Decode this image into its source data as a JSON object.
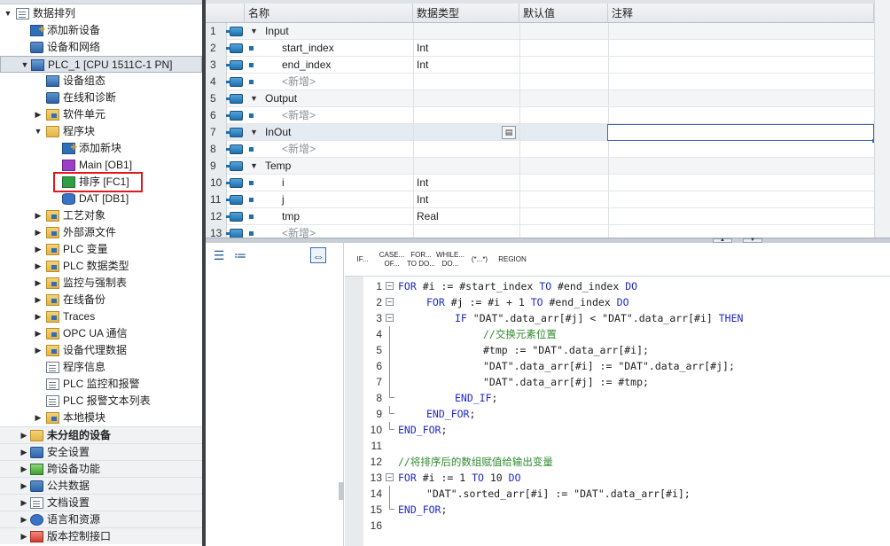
{
  "tree": {
    "items": [
      {
        "label": "数据排列",
        "icon": "project-doc-icon",
        "arrow": "▼",
        "level": 0,
        "kind": "i-doc"
      },
      {
        "label": "添加新设备",
        "icon": "add-device-icon",
        "arrow": "",
        "level": 1,
        "kind": "i-add"
      },
      {
        "label": "设备和网络",
        "icon": "network-icon",
        "arrow": "",
        "level": 1,
        "kind": "i-net"
      },
      {
        "label": "PLC_1 [CPU 1511C-1 PN]",
        "icon": "plc-icon",
        "arrow": "▼",
        "level": 1,
        "kind": "i-plc",
        "selected": true
      },
      {
        "label": "设备组态",
        "icon": "device-config-icon",
        "arrow": "",
        "level": 2,
        "kind": "i-plc"
      },
      {
        "label": "在线和诊断",
        "icon": "diagnostics-icon",
        "arrow": "",
        "level": 2,
        "kind": "i-net"
      },
      {
        "label": "软件单元",
        "icon": "software-units-icon",
        "arrow": "▶",
        "level": 2,
        "kind": "i-folderb"
      },
      {
        "label": "程序块",
        "icon": "program-blocks-folder-icon",
        "arrow": "▼",
        "level": 2,
        "kind": "i-folder"
      },
      {
        "label": "添加新块",
        "icon": "add-block-icon",
        "arrow": "",
        "level": 3,
        "kind": "i-add"
      },
      {
        "label": "Main [OB1]",
        "icon": "ob-block-icon",
        "arrow": "",
        "level": 3,
        "kind": "i-ob"
      },
      {
        "label": "排序 [FC1]",
        "icon": "fc-block-icon",
        "arrow": "",
        "level": 3,
        "kind": "i-fc"
      },
      {
        "label": "DAT [DB1]",
        "icon": "db-block-icon",
        "arrow": "",
        "level": 3,
        "kind": "i-db"
      },
      {
        "label": "工艺对象",
        "icon": "technology-objects-icon",
        "arrow": "▶",
        "level": 2,
        "kind": "i-folderb"
      },
      {
        "label": "外部源文件",
        "icon": "external-sources-icon",
        "arrow": "▶",
        "level": 2,
        "kind": "i-folderb"
      },
      {
        "label": "PLC 变量",
        "icon": "plc-tags-icon",
        "arrow": "▶",
        "level": 2,
        "kind": "i-folderb"
      },
      {
        "label": "PLC 数据类型",
        "icon": "plc-datatypes-icon",
        "arrow": "▶",
        "level": 2,
        "kind": "i-folderb"
      },
      {
        "label": "监控与强制表",
        "icon": "watch-tables-icon",
        "arrow": "▶",
        "level": 2,
        "kind": "i-folderb"
      },
      {
        "label": "在线备份",
        "icon": "online-backup-icon",
        "arrow": "▶",
        "level": 2,
        "kind": "i-folderb"
      },
      {
        "label": "Traces",
        "icon": "traces-icon",
        "arrow": "▶",
        "level": 2,
        "kind": "i-folderb"
      },
      {
        "label": "OPC UA 通信",
        "icon": "opcua-icon",
        "arrow": "▶",
        "level": 2,
        "kind": "i-folderb"
      },
      {
        "label": "设备代理数据",
        "icon": "device-proxy-icon",
        "arrow": "▶",
        "level": 2,
        "kind": "i-folderb"
      },
      {
        "label": "程序信息",
        "icon": "program-info-icon",
        "arrow": "",
        "level": 2,
        "kind": "i-doc"
      },
      {
        "label": "PLC 监控和报警",
        "icon": "plc-alarms-icon",
        "arrow": "",
        "level": 2,
        "kind": "i-doc"
      },
      {
        "label": "PLC 报警文本列表",
        "icon": "alarm-text-list-icon",
        "arrow": "",
        "level": 2,
        "kind": "i-doc"
      },
      {
        "label": "本地模块",
        "icon": "local-modules-icon",
        "arrow": "▶",
        "level": 2,
        "kind": "i-folderb"
      },
      {
        "label": "未分组的设备",
        "icon": "ungrouped-devices-icon",
        "arrow": "▶",
        "level": 1,
        "kind": "i-folder",
        "group": true,
        "bold": true
      },
      {
        "label": "安全设置",
        "icon": "security-icon",
        "arrow": "▶",
        "level": 1,
        "kind": "i-net",
        "group": true
      },
      {
        "label": "跨设备功能",
        "icon": "cross-device-icon",
        "arrow": "▶",
        "level": 1,
        "kind": "i-green",
        "group": true
      },
      {
        "label": "公共数据",
        "icon": "common-data-icon",
        "arrow": "▶",
        "level": 1,
        "kind": "i-net",
        "group": true
      },
      {
        "label": "文档设置",
        "icon": "document-settings-icon",
        "arrow": "▶",
        "level": 1,
        "kind": "i-doc",
        "group": true
      },
      {
        "label": "语言和资源",
        "icon": "language-icon",
        "arrow": "▶",
        "level": 1,
        "kind": "i-gear",
        "group": true
      },
      {
        "label": "版本控制接口",
        "icon": "version-control-icon",
        "arrow": "▶",
        "level": 1,
        "kind": "i-red",
        "group": true
      }
    ]
  },
  "interface": {
    "headers": {
      "name": "名称",
      "type": "数据类型",
      "default": "默认值",
      "comment": "注释"
    },
    "rows": [
      {
        "no": "1",
        "name": "Input",
        "type": "",
        "section": true
      },
      {
        "no": "2",
        "name": "start_index",
        "type": "Int"
      },
      {
        "no": "3",
        "name": "end_index",
        "type": "Int"
      },
      {
        "no": "4",
        "name": "<新增>",
        "type": "",
        "placeholder": true
      },
      {
        "no": "5",
        "name": "Output",
        "type": "",
        "section": true
      },
      {
        "no": "6",
        "name": "<新增>",
        "type": "",
        "placeholder": true
      },
      {
        "no": "7",
        "name": "InOut",
        "type": "",
        "section": true,
        "selected": true
      },
      {
        "no": "8",
        "name": "<新增>",
        "type": "",
        "placeholder": true
      },
      {
        "no": "9",
        "name": "Temp",
        "type": "",
        "section": true
      },
      {
        "no": "10",
        "name": "i",
        "type": "Int"
      },
      {
        "no": "11",
        "name": "j",
        "type": "Int"
      },
      {
        "no": "12",
        "name": "tmp",
        "type": "Real"
      },
      {
        "no": "13",
        "name": "<新增>",
        "type": "",
        "placeholder": true
      }
    ]
  },
  "editor": {
    "toolbar": [
      {
        "label": "IF...",
        "name": "if-button"
      },
      {
        "label": "CASE...\nOF...",
        "name": "case-of-button"
      },
      {
        "label": "FOR...\nTO DO...",
        "name": "for-to-do-button"
      },
      {
        "label": "WHILE...\nDO...",
        "name": "while-do-button"
      },
      {
        "label": "(*...*)",
        "name": "comment-button"
      },
      {
        "label": "REGION",
        "name": "region-button"
      }
    ],
    "lines": [
      {
        "no": "1",
        "fold": "open",
        "indent": 0,
        "parts": [
          [
            "kw",
            "FOR "
          ],
          [
            "tx",
            "#i := #start_index "
          ],
          [
            "kw",
            "TO "
          ],
          [
            "tx",
            "#end_index "
          ],
          [
            "kw",
            "DO"
          ]
        ]
      },
      {
        "no": "2",
        "fold": "open",
        "indent": 4,
        "parts": [
          [
            "kw",
            "FOR "
          ],
          [
            "tx",
            "#j := #i + 1 "
          ],
          [
            "kw",
            "TO "
          ],
          [
            "tx",
            "#end_index "
          ],
          [
            "kw",
            "DO"
          ]
        ]
      },
      {
        "no": "3",
        "fold": "open",
        "indent": 8,
        "parts": [
          [
            "kw",
            "IF "
          ],
          [
            "tx",
            "\"DAT\".data_arr[#j] < \"DAT\".data_arr[#i] "
          ],
          [
            "kw",
            "THEN"
          ]
        ]
      },
      {
        "no": "4",
        "fold": "line",
        "indent": 12,
        "parts": [
          [
            "cm",
            "//交换元素位置"
          ]
        ]
      },
      {
        "no": "5",
        "fold": "line",
        "indent": 12,
        "parts": [
          [
            "tx",
            "#tmp := \"DAT\".data_arr[#i];"
          ]
        ]
      },
      {
        "no": "6",
        "fold": "line",
        "indent": 12,
        "parts": [
          [
            "tx",
            "\"DAT\".data_arr[#i] := \"DAT\".data_arr[#j];"
          ]
        ]
      },
      {
        "no": "7",
        "fold": "line",
        "indent": 12,
        "parts": [
          [
            "tx",
            "\"DAT\".data_arr[#j] := #tmp;"
          ]
        ]
      },
      {
        "no": "8",
        "fold": "end",
        "indent": 8,
        "parts": [
          [
            "kw",
            "END_IF"
          ],
          [
            "tx",
            ";"
          ]
        ]
      },
      {
        "no": "9",
        "fold": "end",
        "indent": 4,
        "parts": [
          [
            "kw",
            "END_FOR"
          ],
          [
            "tx",
            ";"
          ]
        ]
      },
      {
        "no": "10",
        "fold": "end",
        "indent": 0,
        "parts": [
          [
            "kw",
            "END_FOR"
          ],
          [
            "tx",
            ";"
          ]
        ]
      },
      {
        "no": "11",
        "fold": "",
        "indent": 0,
        "parts": []
      },
      {
        "no": "12",
        "fold": "",
        "indent": 0,
        "parts": [
          [
            "cm",
            "//将排序后的数组赋值给输出变量"
          ]
        ]
      },
      {
        "no": "13",
        "fold": "open",
        "indent": 0,
        "parts": [
          [
            "kw",
            "FOR "
          ],
          [
            "tx",
            "#i := 1 "
          ],
          [
            "kw",
            "TO "
          ],
          [
            "tx",
            "10 "
          ],
          [
            "kw",
            "DO"
          ]
        ]
      },
      {
        "no": "14",
        "fold": "line",
        "indent": 4,
        "parts": [
          [
            "tx",
            "\"DAT\".sorted_arr[#i] := \"DAT\".data_arr[#i];"
          ]
        ]
      },
      {
        "no": "15",
        "fold": "end",
        "indent": 0,
        "parts": [
          [
            "kw",
            "END_FOR"
          ],
          [
            "tx",
            ";"
          ]
        ]
      },
      {
        "no": "16",
        "fold": "",
        "indent": 0,
        "parts": []
      }
    ]
  },
  "colors": {
    "keyword": "#1f2ac9",
    "comment": "#2f8a2f",
    "highlight": "#e0191e",
    "selection": "#3a6bb5"
  }
}
